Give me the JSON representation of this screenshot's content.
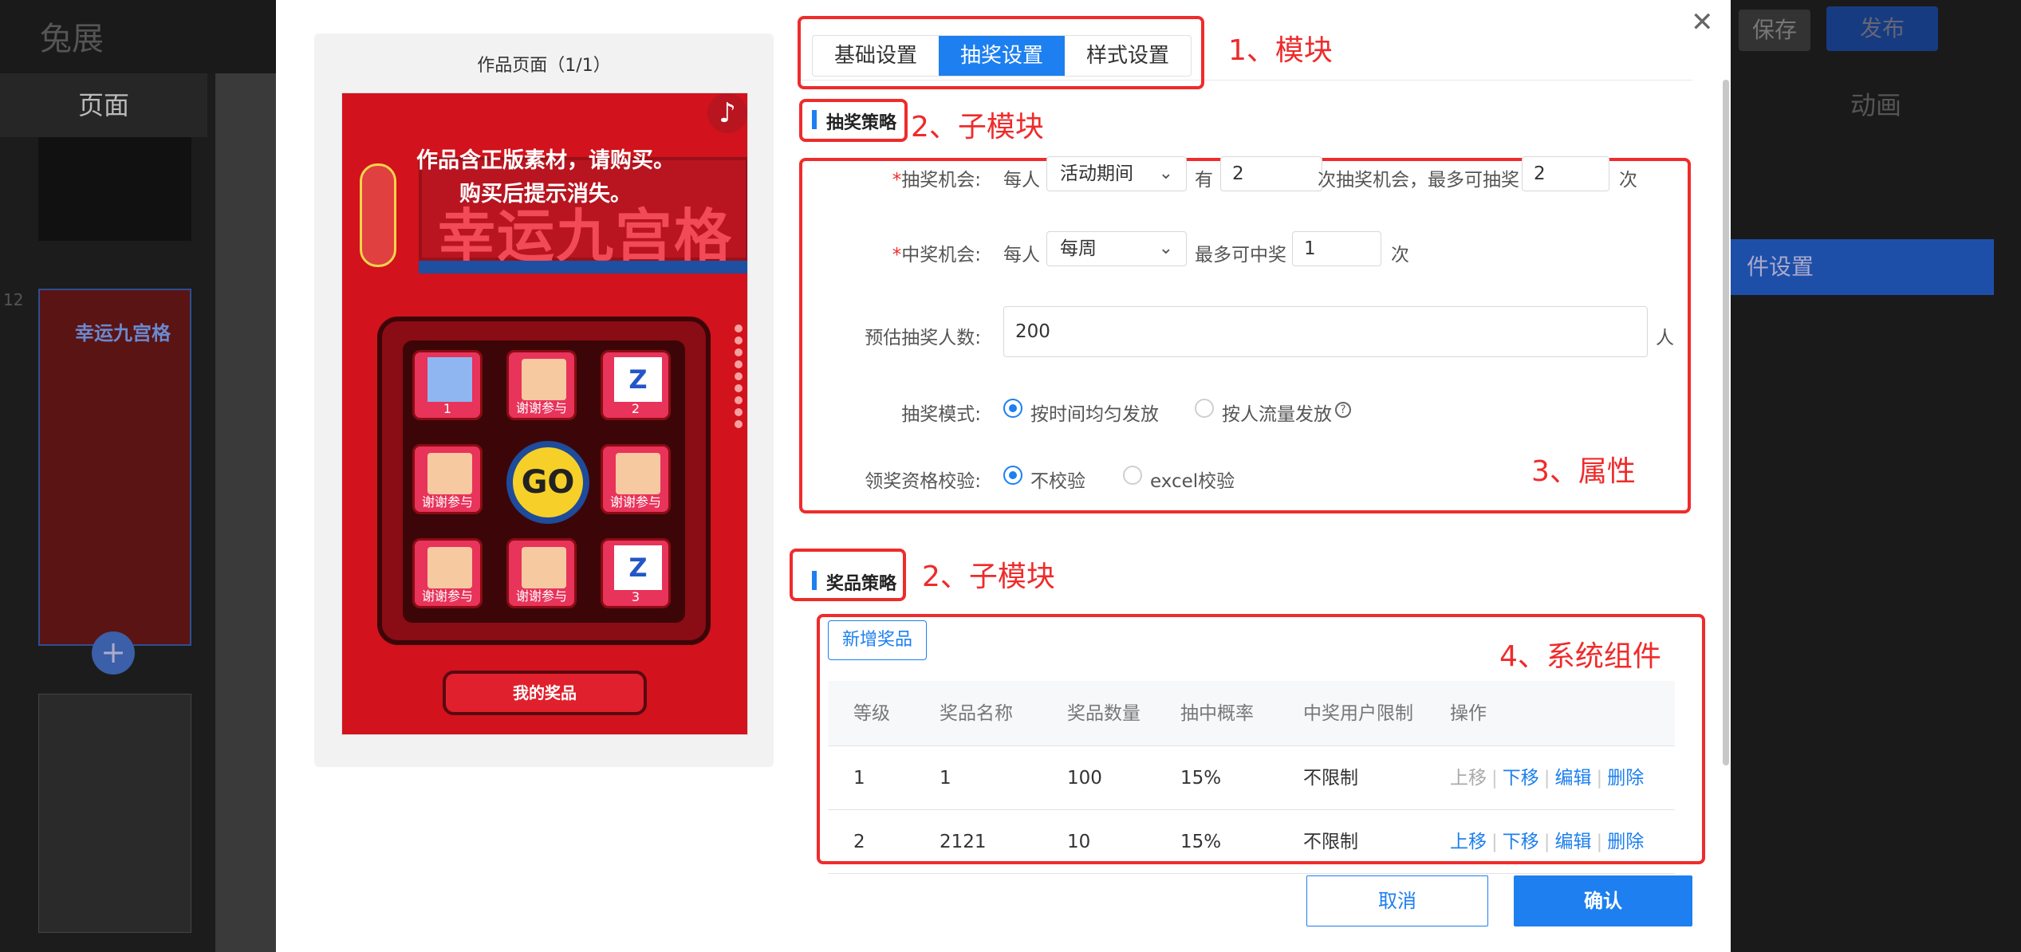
{
  "background": {
    "logo": "兔展",
    "left_menu": "页面",
    "right_tab": "动画",
    "right_button": "件设置",
    "save": "保存",
    "publish": "发布",
    "page_num": "12",
    "thumb_title": "幸运九宫格"
  },
  "preview": {
    "title": "作品页面（1/1）",
    "notice_line1": "作品含正版素材，请购买。",
    "notice_line2": "购买后提示消失。",
    "game_title": "幸运九宫格",
    "cells": [
      "1",
      "谢谢参与",
      "2",
      "谢谢参与",
      "谢谢参与",
      "谢谢参与",
      "谢谢参与",
      "3"
    ],
    "go": "GO",
    "my_prize": "我的奖品",
    "logo_text": "Z"
  },
  "tabs": [
    "基础设置",
    "抽奖设置",
    "样式设置"
  ],
  "annotations": {
    "module": "1、模块",
    "submodule": "2、子模块",
    "property": "3、属性",
    "component": "4、系统组件"
  },
  "lottery_strategy": {
    "title": "抽奖策略",
    "chance_label": "抽奖机会:",
    "per_person": "每人",
    "period_select": "活动期间",
    "have": "有",
    "chance_count": "2",
    "chance_suffix": "次抽奖机会，最多可抽奖",
    "max_draw": "2",
    "times": "次",
    "win_label": "中奖机会:",
    "win_period": "每周",
    "max_win_text": "最多可中奖",
    "max_win": "1",
    "est_label": "预估抽奖人数:",
    "est_value": "200",
    "est_unit": "人",
    "mode_label": "抽奖模式:",
    "mode_opt1": "按时间均匀发放",
    "mode_opt2": "按人流量发放",
    "check_label": "领奖资格校验:",
    "check_opt1": "不校验",
    "check_opt2": "excel校验"
  },
  "prize_strategy": {
    "title": "奖品策略",
    "add_button": "新增奖品",
    "columns": [
      "等级",
      "奖品名称",
      "奖品数量",
      "抽中概率",
      "中奖用户限制",
      "操作"
    ],
    "rows": [
      {
        "level": "1",
        "name": "1",
        "qty": "100",
        "prob": "15%",
        "limit": "不限制"
      },
      {
        "level": "2",
        "name": "2121",
        "qty": "10",
        "prob": "15%",
        "limit": "不限制"
      }
    ],
    "ops": {
      "up": "上移",
      "down": "下移",
      "edit": "编辑",
      "delete": "删除"
    }
  },
  "footer": {
    "cancel": "取消",
    "confirm": "确认"
  },
  "colors": {
    "primary": "#1d7ff0",
    "annotation": "#ef2b2b",
    "game_bg": "#d2121c"
  }
}
